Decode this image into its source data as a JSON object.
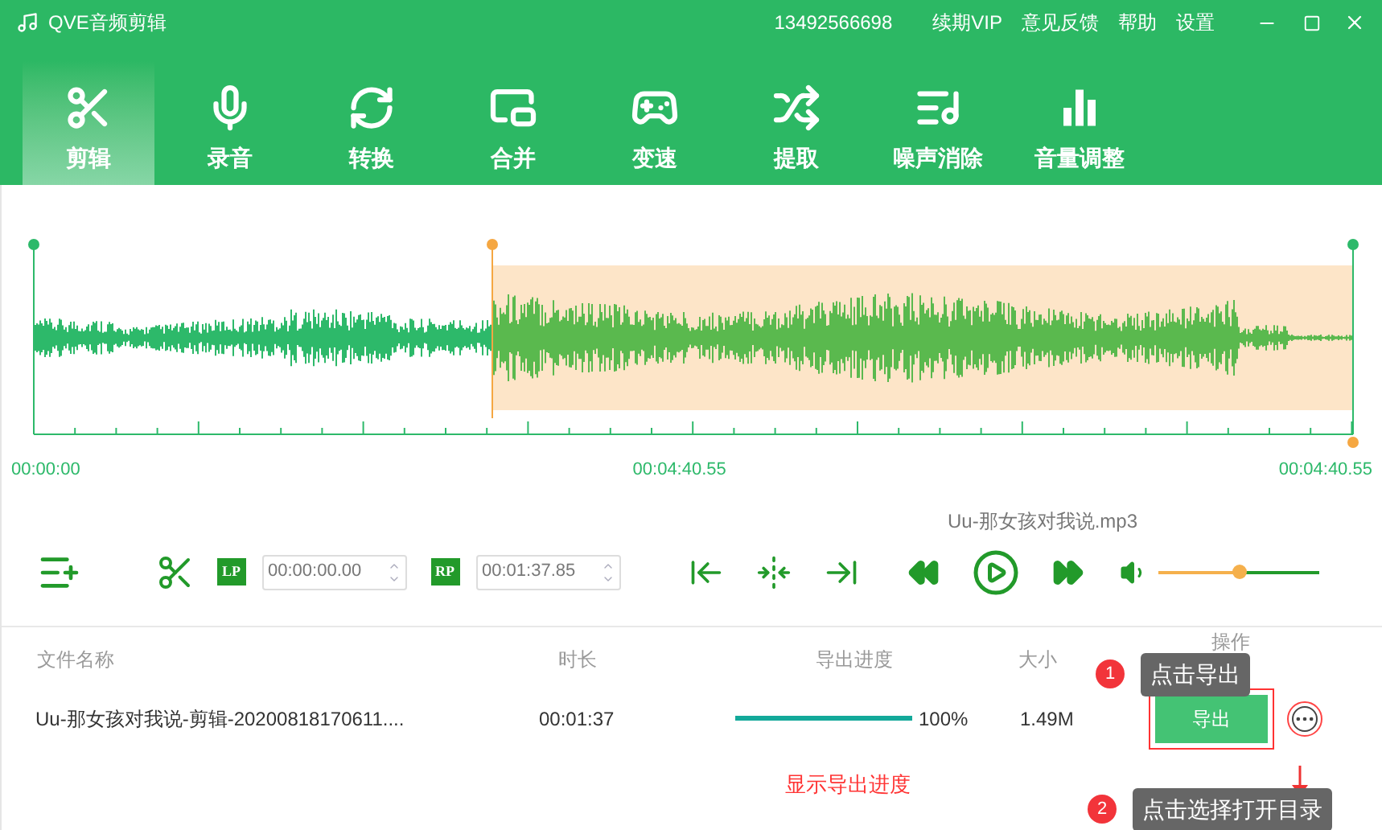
{
  "window": {
    "title": "QVE音频剪辑",
    "phone": "13492566698",
    "links": [
      "续期VIP",
      "意见反馈",
      "帮助",
      "设置"
    ]
  },
  "tabs": [
    {
      "label": "剪辑",
      "kind": "cut",
      "selected": true
    },
    {
      "label": "录音",
      "kind": "record",
      "selected": false
    },
    {
      "label": "转换",
      "kind": "convert",
      "selected": false
    },
    {
      "label": "合并",
      "kind": "merge",
      "selected": false
    },
    {
      "label": "变速",
      "kind": "speed",
      "selected": false
    },
    {
      "label": "提取",
      "kind": "extract",
      "selected": false
    },
    {
      "label": "噪声消除",
      "kind": "denoise",
      "selected": false
    },
    {
      "label": "音量调整",
      "kind": "volume",
      "selected": false
    }
  ],
  "timeline": {
    "start": "00:00:00",
    "middle": "00:04:40.55",
    "end": "00:04:40.55"
  },
  "controls": {
    "lp_label": "LP",
    "lp_value": "00:00:00.00",
    "rp_label": "RP",
    "rp_value": "00:01:37.85",
    "file_name": "Uu-那女孩对我说.mp3",
    "volume": {
      "level": 0.5
    }
  },
  "table": {
    "columns": [
      "文件名称",
      "时长",
      "导出进度",
      "大小",
      "操作"
    ],
    "rows": [
      {
        "name": "Uu-那女孩对我说-剪辑-20200818170611....",
        "duration": "00:01:37",
        "progress": {
          "level": 1
        },
        "percent": "100%",
        "size": "1.49M",
        "action": "导出"
      }
    ]
  },
  "annotations": [
    {
      "number": "1",
      "text": "点击导出"
    },
    {
      "number": "2",
      "text": "点击选择打开目录"
    }
  ],
  "progress_note": "显示导出进度"
}
